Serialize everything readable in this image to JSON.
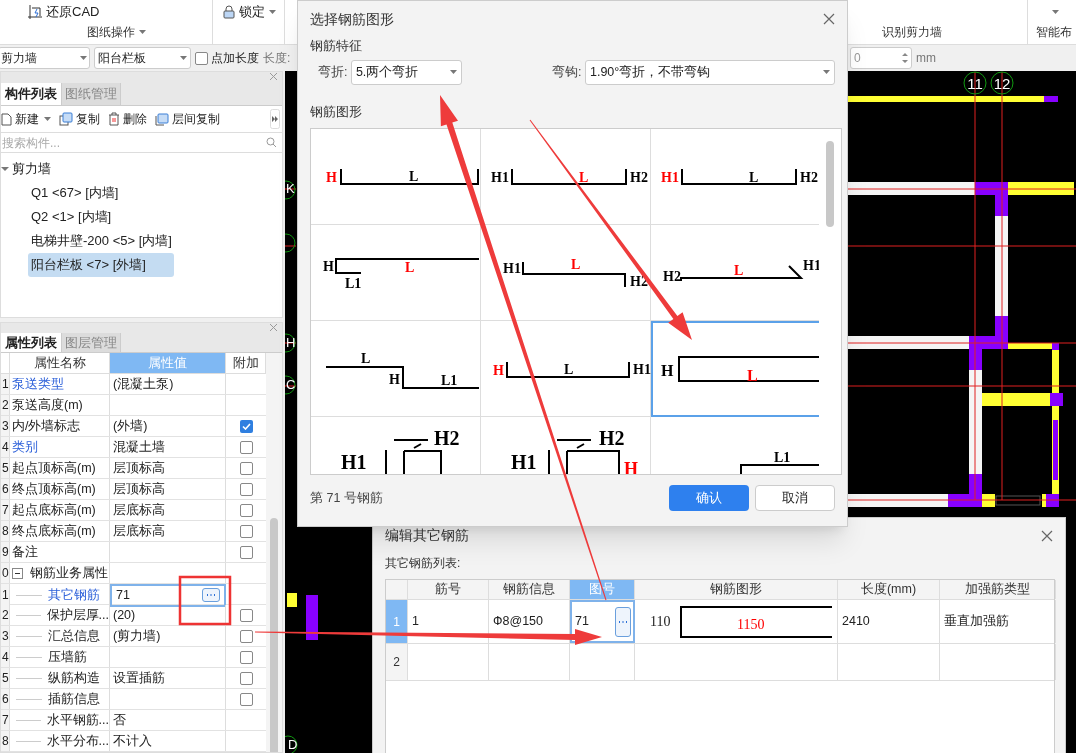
{
  "ribbon": {
    "restore_cad": "还原CAD",
    "drawing_ops": "图纸操作",
    "lock": "锁定",
    "recognize_wall": "识别剪力墙",
    "smart_layout": "智能布"
  },
  "toolbar": {
    "type_select": "剪力墙",
    "component_select": "阳台栏板",
    "add_length": {
      "label": "点加长度",
      "checked": false
    },
    "length_label": "长度:",
    "length_value": "0",
    "unit": "mm"
  },
  "component_panel": {
    "tabs": [
      {
        "label": "构件列表",
        "selected": true
      },
      {
        "label": "图纸管理",
        "selected": false
      }
    ],
    "actions": [
      "新建",
      "复制",
      "删除",
      "层间复制"
    ],
    "search": {
      "placeholder": "搜索构件..."
    },
    "tree": [
      {
        "label": "剪力墙",
        "expanded": true,
        "children": [
          {
            "label": "Q1 <67> [内墙]",
            "selected": false
          },
          {
            "label": "Q2 <1> [内墙]",
            "selected": false
          },
          {
            "label": "电梯井壁-200 <5> [内墙]",
            "selected": false
          },
          {
            "label": "阳台栏板 <7> [外墙]",
            "selected": true
          }
        ]
      }
    ]
  },
  "property_panel": {
    "tabs": [
      {
        "label": "属性列表",
        "selected": true
      },
      {
        "label": "图层管理",
        "selected": false
      }
    ],
    "columns": [
      {
        "label": "属性名称",
        "selected": false
      },
      {
        "label": "属性值",
        "selected": true
      },
      {
        "label": "附加",
        "selected": false
      }
    ],
    "rows": [
      {
        "index": "1",
        "name": "泵送类型",
        "value": "(混凝土泵)",
        "link": true,
        "selected": false
      },
      {
        "index": "2",
        "name": "泵送高度(m)",
        "link": false,
        "selected": false
      },
      {
        "index": "3",
        "name": "内/外墙标志",
        "value": "(外墙)",
        "link": false,
        "selected": false,
        "checked": true
      },
      {
        "index": "4",
        "name": "类别",
        "value": "混凝土墙",
        "link": true,
        "selected": false,
        "checked": false
      },
      {
        "index": "5",
        "name": "起点顶标高(m)",
        "value": "层顶标高",
        "link": false,
        "selected": false,
        "checked": false
      },
      {
        "index": "6",
        "name": "终点顶标高(m)",
        "value": "层顶标高",
        "link": false,
        "selected": false,
        "checked": false
      },
      {
        "index": "7",
        "name": "起点底标高(m)",
        "value": "层底标高",
        "link": false,
        "selected": false,
        "checked": false
      },
      {
        "index": "8",
        "name": "终点底标高(m)",
        "value": "层底标高",
        "link": false,
        "selected": false,
        "checked": false
      },
      {
        "index": "9",
        "name": "备注",
        "link": false,
        "selected": false,
        "checked": false
      },
      {
        "index": "0",
        "name": "钢筋业务属性",
        "link": false,
        "selected": false,
        "expanded": true,
        "children": [
          {
            "index": "1",
            "name": "其它钢筋",
            "value": "71",
            "link": true,
            "selected": true
          },
          {
            "index": "2",
            "name": "保护层厚...",
            "value": "(20)",
            "link": false,
            "selected": false,
            "checked": false
          },
          {
            "index": "3",
            "name": "汇总信息",
            "value": "(剪力墙)",
            "link": false,
            "selected": false,
            "checked": false
          },
          {
            "index": "4",
            "name": "压墙筋",
            "link": false,
            "selected": false,
            "checked": false
          },
          {
            "index": "5",
            "name": "纵筋构造",
            "value": "设置插筋",
            "link": false,
            "selected": false,
            "checked": false
          },
          {
            "index": "6",
            "name": "插筋信息",
            "link": false,
            "selected": false,
            "checked": false
          },
          {
            "index": "7",
            "name": "水平钢筋...",
            "value": "否",
            "link": false,
            "selected": false
          },
          {
            "index": "8",
            "name": "水平分布...",
            "value": "不计入",
            "link": false,
            "selected": false
          }
        ]
      }
    ]
  },
  "canvas": {
    "axes": [
      "11",
      "12"
    ],
    "edge_axes": [
      "K",
      "H",
      "C",
      "D"
    ]
  },
  "shape_dialog": {
    "title": "选择钢筋图形",
    "features_heading": "钢筋特征",
    "bend_label": "弯折:",
    "bend_value": "5.两个弯折",
    "hook_label": "弯钩:",
    "hook_value": "1.90°弯折，不带弯钩",
    "shapes_heading": "钢筋图形",
    "shapes": [
      {
        "kind": "hookleft",
        "selected": false,
        "labels": [
          {
            "text": "H",
            "color": "#ff0000"
          },
          {
            "text": "L",
            "color": "#000000"
          }
        ]
      },
      {
        "kind": "channel",
        "selected": false,
        "labels": [
          {
            "text": "H1",
            "color": "#000000"
          },
          {
            "text": "L",
            "color": "#ff0000"
          },
          {
            "text": "H2",
            "color": "#000000"
          }
        ]
      },
      {
        "kind": "channel",
        "selected": false,
        "labels": [
          {
            "text": "H1",
            "color": "#ff0000"
          },
          {
            "text": "L",
            "color": "#000000"
          },
          {
            "text": "H2",
            "color": "#000000"
          }
        ]
      },
      {
        "kind": "lhook",
        "selected": false,
        "labels": [
          {
            "text": "H",
            "color": "#000000"
          },
          {
            "text": "L",
            "color": "#ff0000"
          },
          {
            "text": "L1",
            "color": "#000000"
          }
        ]
      },
      {
        "kind": "zstep",
        "selected": false,
        "labels": [
          {
            "text": "H1",
            "color": "#000000"
          },
          {
            "text": "L",
            "color": "#ff0000"
          },
          {
            "text": "H2",
            "color": "#000000"
          }
        ]
      },
      {
        "kind": "hookend",
        "selected": false,
        "labels": [
          {
            "text": "H2",
            "color": "#000000"
          },
          {
            "text": "L",
            "color": "#ff0000"
          },
          {
            "text": "H1",
            "color": "#000000"
          }
        ]
      },
      {
        "kind": "step",
        "selected": false,
        "labels": [
          {
            "text": "L",
            "color": "#000000"
          },
          {
            "text": "H",
            "color": "#000000"
          },
          {
            "text": "L1",
            "color": "#000000"
          }
        ]
      },
      {
        "kind": "channel2",
        "selected": false,
        "labels": [
          {
            "text": "H",
            "color": "#ff0000"
          },
          {
            "text": "L",
            "color": "#000000"
          },
          {
            "text": "H1",
            "color": "#000000"
          }
        ]
      },
      {
        "kind": "open",
        "selected": true,
        "labels": [
          {
            "text": "H",
            "color": "#000000"
          },
          {
            "text": "L",
            "color": "#ff0000"
          }
        ]
      },
      {
        "kind": "stirrup",
        "selected": false,
        "labels": [
          {
            "text": "H1",
            "color": "#000000"
          },
          {
            "text": "H2",
            "color": "#000000"
          }
        ]
      },
      {
        "kind": "stirrup2",
        "selected": false,
        "labels": [
          {
            "text": "H1",
            "color": "#000000"
          },
          {
            "text": "H2",
            "color": "#000000"
          },
          {
            "text": "H",
            "color": "#ff0000"
          }
        ]
      },
      {
        "kind": "rect",
        "selected": false,
        "labels": [
          {
            "text": "L1",
            "color": "#000000"
          }
        ]
      }
    ],
    "footer": "第 71 号钢筋",
    "confirm": "确认",
    "cancel": "取消"
  },
  "rebar_dialog": {
    "title": "编辑其它钢筋",
    "list_label": "其它钢筋列表:",
    "columns": [
      {
        "label": "筋号",
        "selected": false
      },
      {
        "label": "钢筋信息",
        "selected": false
      },
      {
        "label": "图号",
        "selected": true
      },
      {
        "label": "钢筋图形",
        "selected": false
      },
      {
        "label": "长度(mm)",
        "selected": false
      },
      {
        "label": "加强筋类型",
        "selected": false
      }
    ],
    "rows": [
      {
        "index": "1",
        "selected": true,
        "bar_no": "1",
        "info": "Ф8@150",
        "shape_no": "71",
        "shape_labels": [
          "110",
          "1150"
        ],
        "length": "2410",
        "type": "垂直加强筋"
      },
      {
        "index": "2",
        "selected": false
      }
    ]
  }
}
